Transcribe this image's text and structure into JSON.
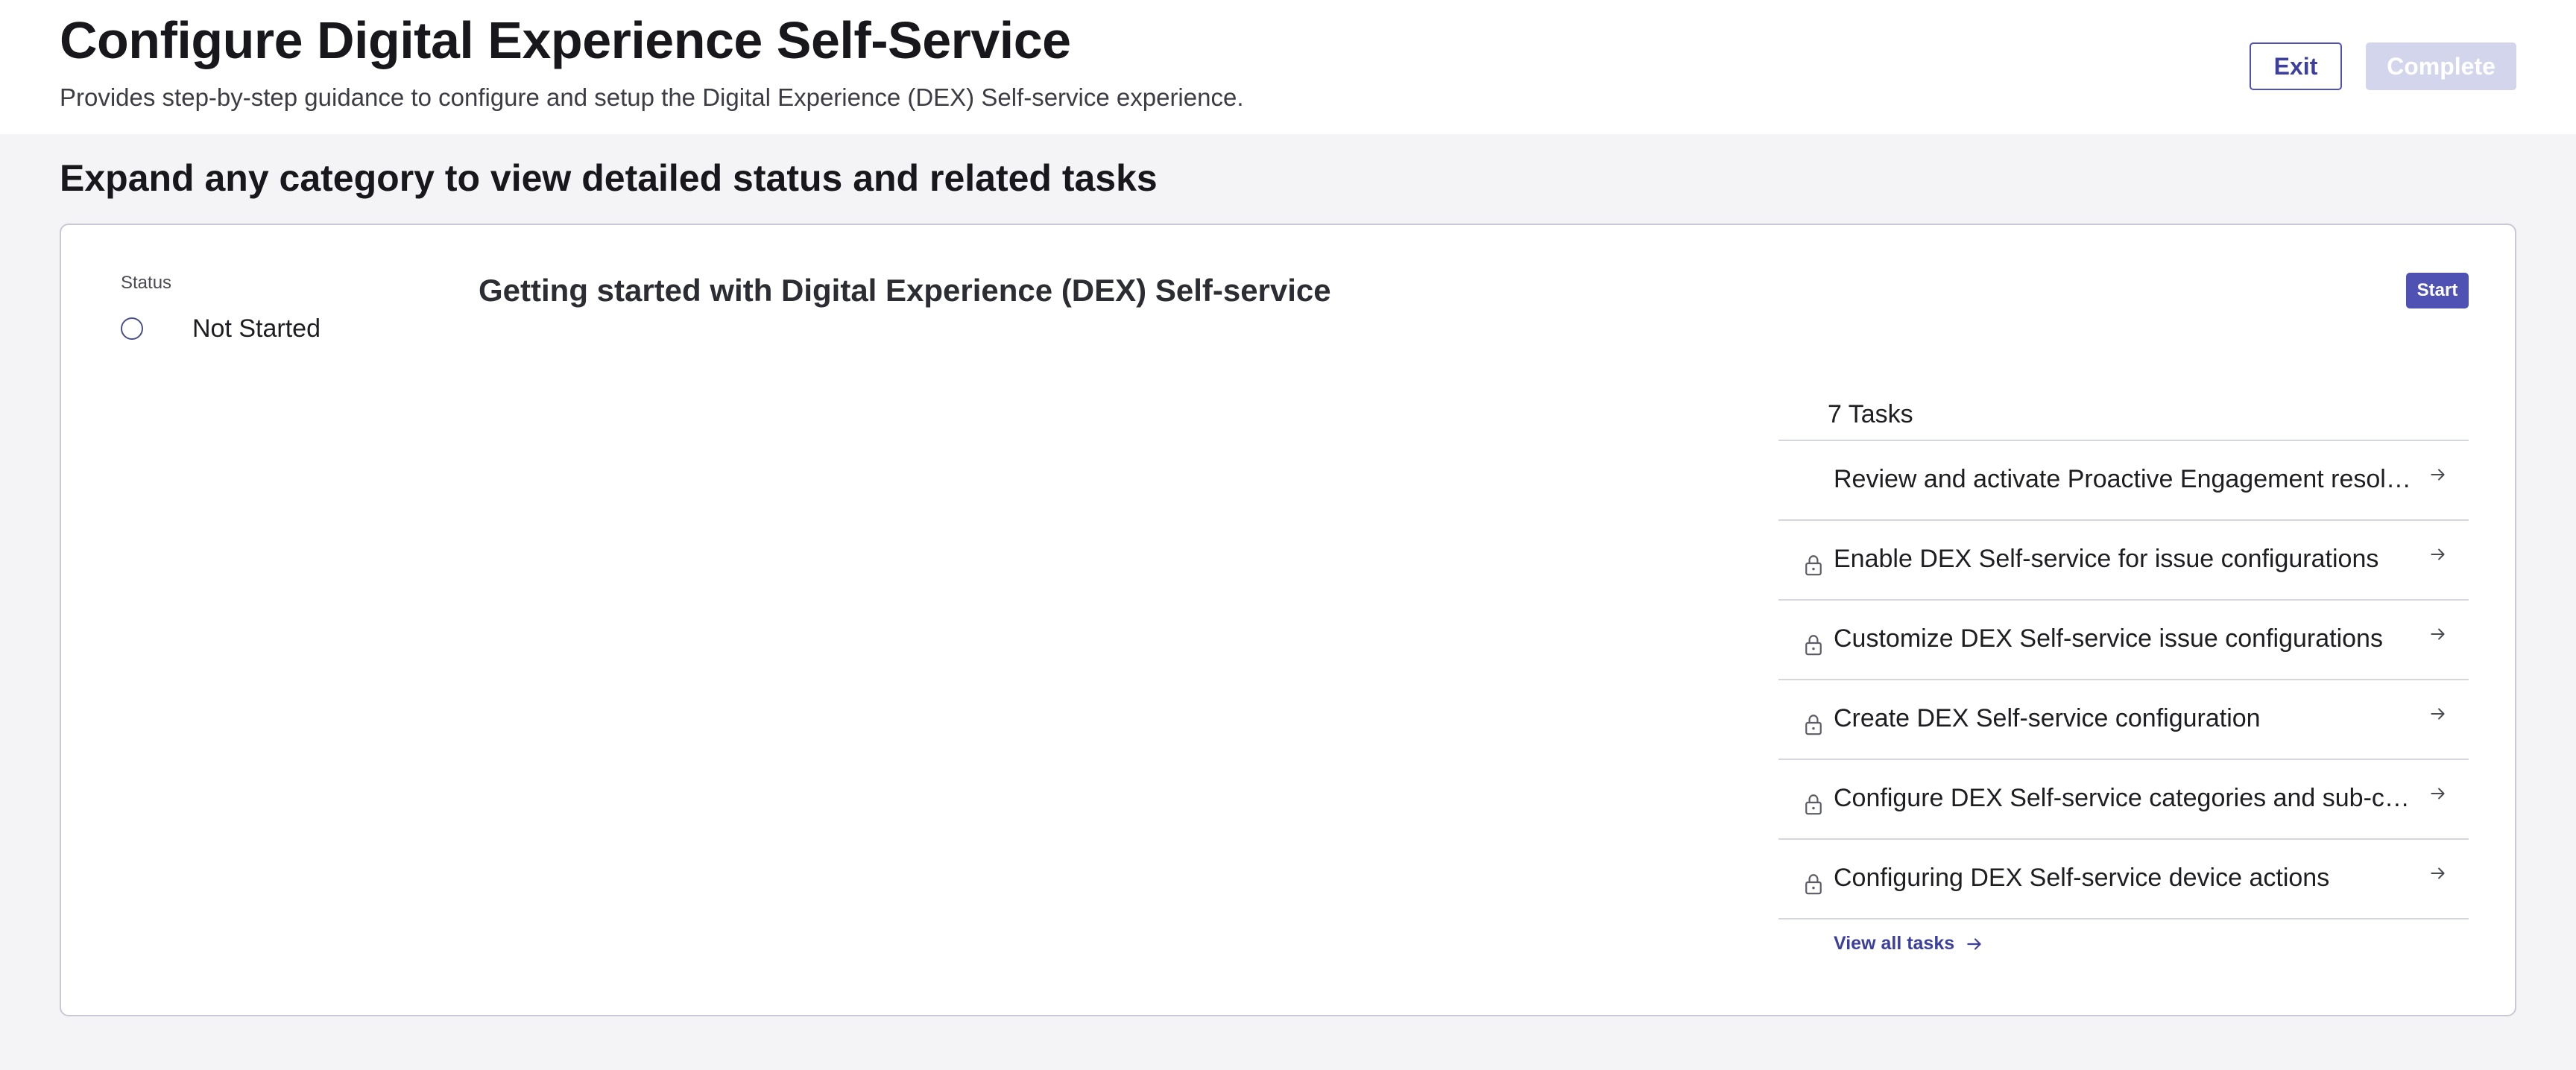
{
  "header": {
    "title": "Configure Digital Experience Self-Service",
    "subtitle": "Provides step-by-step guidance to configure and setup the Digital Experience (DEX) Self-service experience.",
    "exit_label": "Exit",
    "complete_label": "Complete"
  },
  "main": {
    "section_heading": "Expand any category to view detailed status and related tasks",
    "category": {
      "status_label": "Status",
      "status_value": "Not Started",
      "title": "Getting started with Digital Experience (DEX) Self-service",
      "start_label": "Start",
      "tasks_count": "7 Tasks",
      "tasks": [
        {
          "label": "Review and activate Proactive Engagement resolutions",
          "locked": false
        },
        {
          "label": "Enable DEX Self-service for issue configurations",
          "locked": true
        },
        {
          "label": "Customize DEX Self-service issue configurations",
          "locked": true
        },
        {
          "label": "Create DEX Self-service configuration",
          "locked": true
        },
        {
          "label": "Configure DEX Self-service categories and sub-categories",
          "locked": true
        },
        {
          "label": "Configuring DEX Self-service device actions",
          "locked": true
        }
      ],
      "view_all_label": "View all tasks"
    }
  },
  "icons": {
    "lock": "lock-icon",
    "arrow": "arrow-right-icon",
    "status": "status-circle-icon"
  },
  "colors": {
    "accent": "#4f52b2",
    "accent_disabled": "#d3d5ec",
    "background": "#f4f4f6",
    "border": "#c8c9d3"
  }
}
